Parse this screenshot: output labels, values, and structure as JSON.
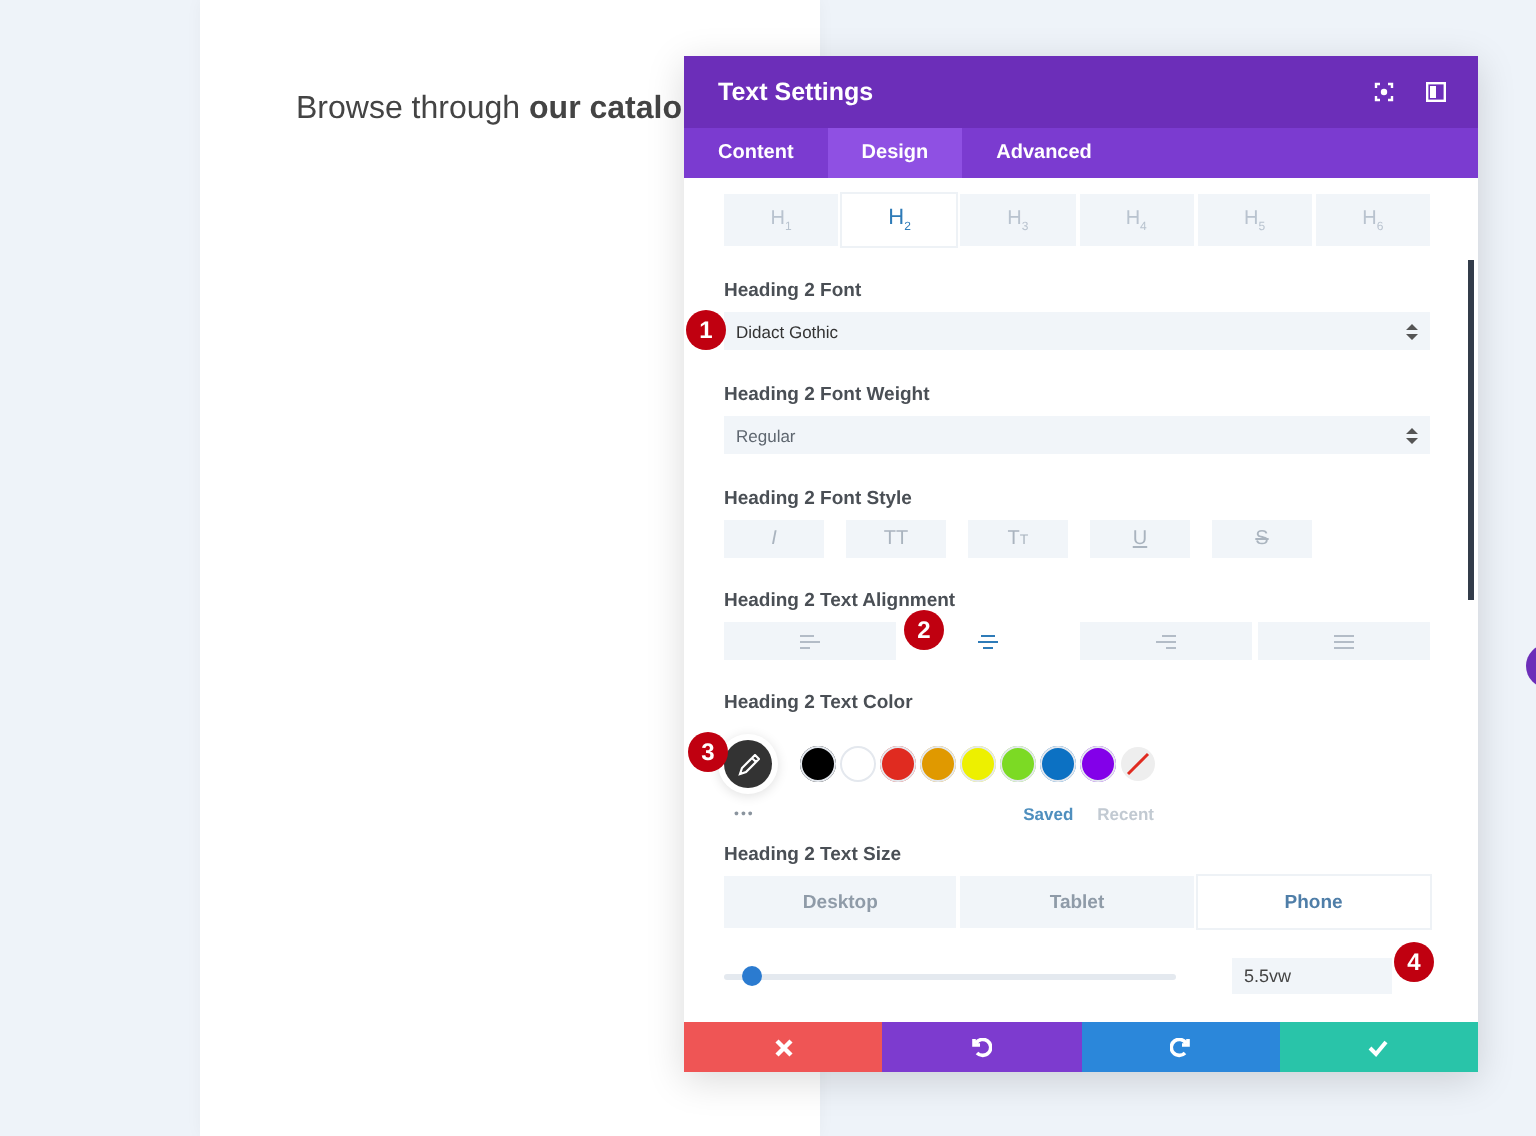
{
  "page": {
    "text": "Browse through **our catalo**"
  },
  "panel": {
    "title": "Text Settings",
    "tabs": [
      {
        "label": "Content",
        "selected": false
      },
      {
        "label": "Design",
        "selected": true
      },
      {
        "label": "Advanced",
        "selected": false
      }
    ],
    "heading_levels": [
      {
        "label": "H$_{1}$",
        "selected": false
      },
      {
        "label": "H$_{2}$",
        "selected": true
      },
      {
        "label": "H$_{3}$",
        "selected": false
      },
      {
        "label": "H$_{4}$",
        "selected": false
      },
      {
        "label": "H$_{5}$",
        "selected": false
      },
      {
        "label": "H$_{6}$",
        "selected": false
      }
    ],
    "font": {
      "label": "Heading 2 Font",
      "value": "Didact Gothic"
    },
    "font_weight": {
      "label": "Heading 2 Font Weight",
      "value": "Regular"
    },
    "font_style": {
      "label": "Heading 2 Font Style",
      "buttons": [
        {
          "label": "I",
          "kind": "italic"
        },
        {
          "label": "TT",
          "kind": "plain"
        },
        {
          "label": "Tt",
          "kind": "smallcaps"
        },
        {
          "label": "U",
          "kind": "underline"
        },
        {
          "label": "S",
          "kind": "strike"
        }
      ]
    },
    "alignment": {
      "label": "Heading 2 Text Alignment",
      "options": [
        {
          "kind": "left",
          "selected": false
        },
        {
          "kind": "center",
          "selected": true
        },
        {
          "kind": "right",
          "selected": false
        },
        {
          "kind": "justify",
          "selected": false
        }
      ]
    },
    "text_color": {
      "label": "Heading 2 Text Color",
      "swatches": [
        {
          "kind": "picker",
          "color": "#333333"
        },
        {
          "kind": "swatch",
          "color": "#000000"
        },
        {
          "kind": "swatch",
          "color": "#ffffff"
        },
        {
          "kind": "swatch",
          "color": "#e02b20"
        },
        {
          "kind": "swatch",
          "color": "#e09900"
        },
        {
          "kind": "swatch",
          "color": "#edf000"
        },
        {
          "kind": "swatch",
          "color": "#7cda24"
        },
        {
          "kind": "swatch",
          "color": "#0c71c3"
        },
        {
          "kind": "swatch",
          "color": "#8300e9"
        },
        {
          "kind": "none",
          "color": "#e02b20"
        }
      ],
      "more": "•••",
      "palette_tabs": [
        {
          "label": "Saved",
          "selected": true
        },
        {
          "label": "Recent",
          "selected": false
        }
      ]
    },
    "text_size": {
      "label": "Heading 2 Text Size",
      "devices": [
        {
          "label": "Desktop",
          "selected": false
        },
        {
          "label": "Tablet",
          "selected": false
        },
        {
          "label": "Phone",
          "selected": true
        }
      ],
      "level": 0.06,
      "value": "5.5vw"
    },
    "footer": [
      {
        "kind": "cancel"
      },
      {
        "kind": "undo"
      },
      {
        "kind": "redo"
      },
      {
        "kind": "save"
      }
    ],
    "annotations": [
      "1",
      "2",
      "3",
      "4"
    ]
  }
}
